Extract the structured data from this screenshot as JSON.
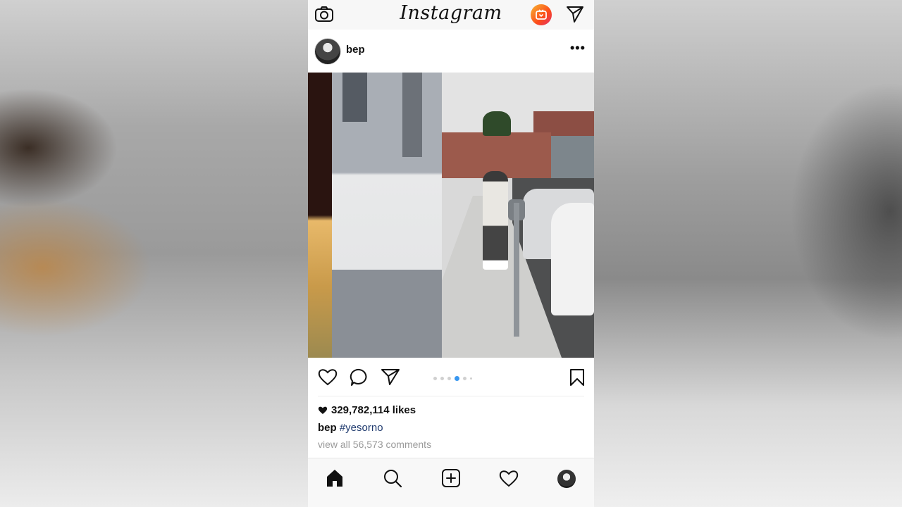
{
  "app": {
    "logo_text": "Instagram"
  },
  "post": {
    "username": "bep",
    "likes": "329,782,114 likes",
    "caption_user": "bep",
    "caption_hashtag": "#yesorno",
    "comments_link": "view all 56,573 comments",
    "carousel": {
      "count": 6,
      "active_index": 3
    }
  },
  "icons": {
    "top_left": "camera-icon",
    "top_right_1": "igtv-icon",
    "top_right_2": "direct-send-icon",
    "post_menu": "more-dots-icon",
    "actions": [
      "heart-icon",
      "comment-icon",
      "share-icon",
      "bookmark-icon"
    ],
    "nav": [
      "home-icon",
      "search-icon",
      "add-post-icon",
      "activity-heart-icon",
      "profile-avatar"
    ]
  },
  "colors": {
    "hashtag": "#1f3a6e",
    "carousel_active": "#3897f0",
    "muted_text": "#9a9a9a"
  }
}
